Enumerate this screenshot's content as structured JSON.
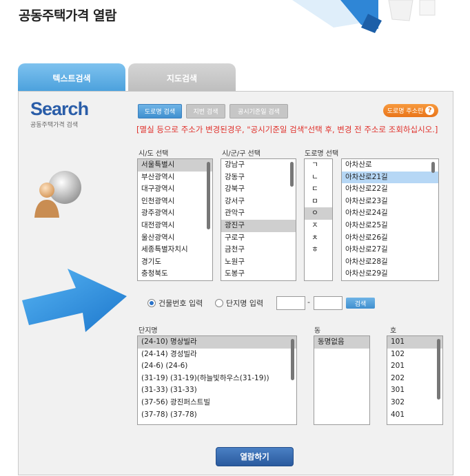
{
  "page": {
    "title": "공동주택가격 열람"
  },
  "tabs": [
    {
      "label": "텍스트검색",
      "active": true
    },
    {
      "label": "지도검색",
      "active": false
    }
  ],
  "logo": {
    "word": "Search",
    "sub": "공동주택가격 검색"
  },
  "search_modes": {
    "road": "도로명 검색",
    "lot": "지번 검색",
    "notice": "공시기준일 검색"
  },
  "address_help": {
    "label": "도로명 주소란",
    "icon": "question-icon"
  },
  "notice_text": "[멸실 등으로 주소가 변경된경우, \"공시기준일 검색\"선택 후, 변경 전 주소로 조회하십시오.]",
  "columns": {
    "sido": "시/도 선택",
    "sigungu": "시/군/구 선택",
    "road": "도로명 선택",
    "complex": "단지명",
    "dong": "동",
    "ho": "호"
  },
  "sido_list": {
    "items": [
      "서울특별시",
      "부산광역시",
      "대구광역시",
      "인천광역시",
      "광주광역시",
      "대전광역시",
      "울산광역시",
      "세종특별자치시",
      "경기도",
      "충청북도"
    ],
    "selected": "서울특별시"
  },
  "sigungu_list": {
    "items": [
      "강남구",
      "강동구",
      "강북구",
      "강서구",
      "관악구",
      "광진구",
      "구로구",
      "금천구",
      "노원구",
      "도봉구"
    ],
    "selected": "광진구"
  },
  "initial_list": {
    "items": [
      "ㄱ",
      "ㄴ",
      "ㄷ",
      "ㅁ",
      "ㅇ",
      "ㅈ",
      "ㅊ",
      "ㅎ"
    ],
    "selected": "ㅇ"
  },
  "road_list": {
    "items": [
      "아차산로",
      "아차산로21길",
      "아차산로22길",
      "아차산로23길",
      "아차산로24길",
      "아차산로25길",
      "아차산로26길",
      "아차산로27길",
      "아차산로28길",
      "아차산로29길"
    ],
    "selected": "아차산로21길"
  },
  "input_mode": {
    "building_label": "건물번호 입력",
    "complex_label": "단지명 입력",
    "selected": "building",
    "search_label": "검색",
    "separator": "-"
  },
  "complex_list": {
    "items": [
      "(24-10) 명상빌라",
      "(24-14) 경성빌라",
      "(24-6) (24-6)",
      "(31-19) (31-19)(하늘빛하우스(31-19))",
      "(31-33) (31-33)",
      "(37-56) 광진퍼스트빌",
      "(37-78) (37-78)"
    ],
    "selected": "(24-10) 명상빌라"
  },
  "dong_list": {
    "items": [
      "동명없음"
    ],
    "selected": "동명없음"
  },
  "ho_list": {
    "items": [
      "101",
      "102",
      "201",
      "202",
      "301",
      "302",
      "401"
    ],
    "selected": "101"
  },
  "view_button": {
    "label": "열람하기"
  },
  "colors": {
    "accent_blue": "#4aa0dc",
    "notice_red": "#e0302a",
    "arrow_blue": "#2e8fe0",
    "help_orange": "#e9741a"
  }
}
